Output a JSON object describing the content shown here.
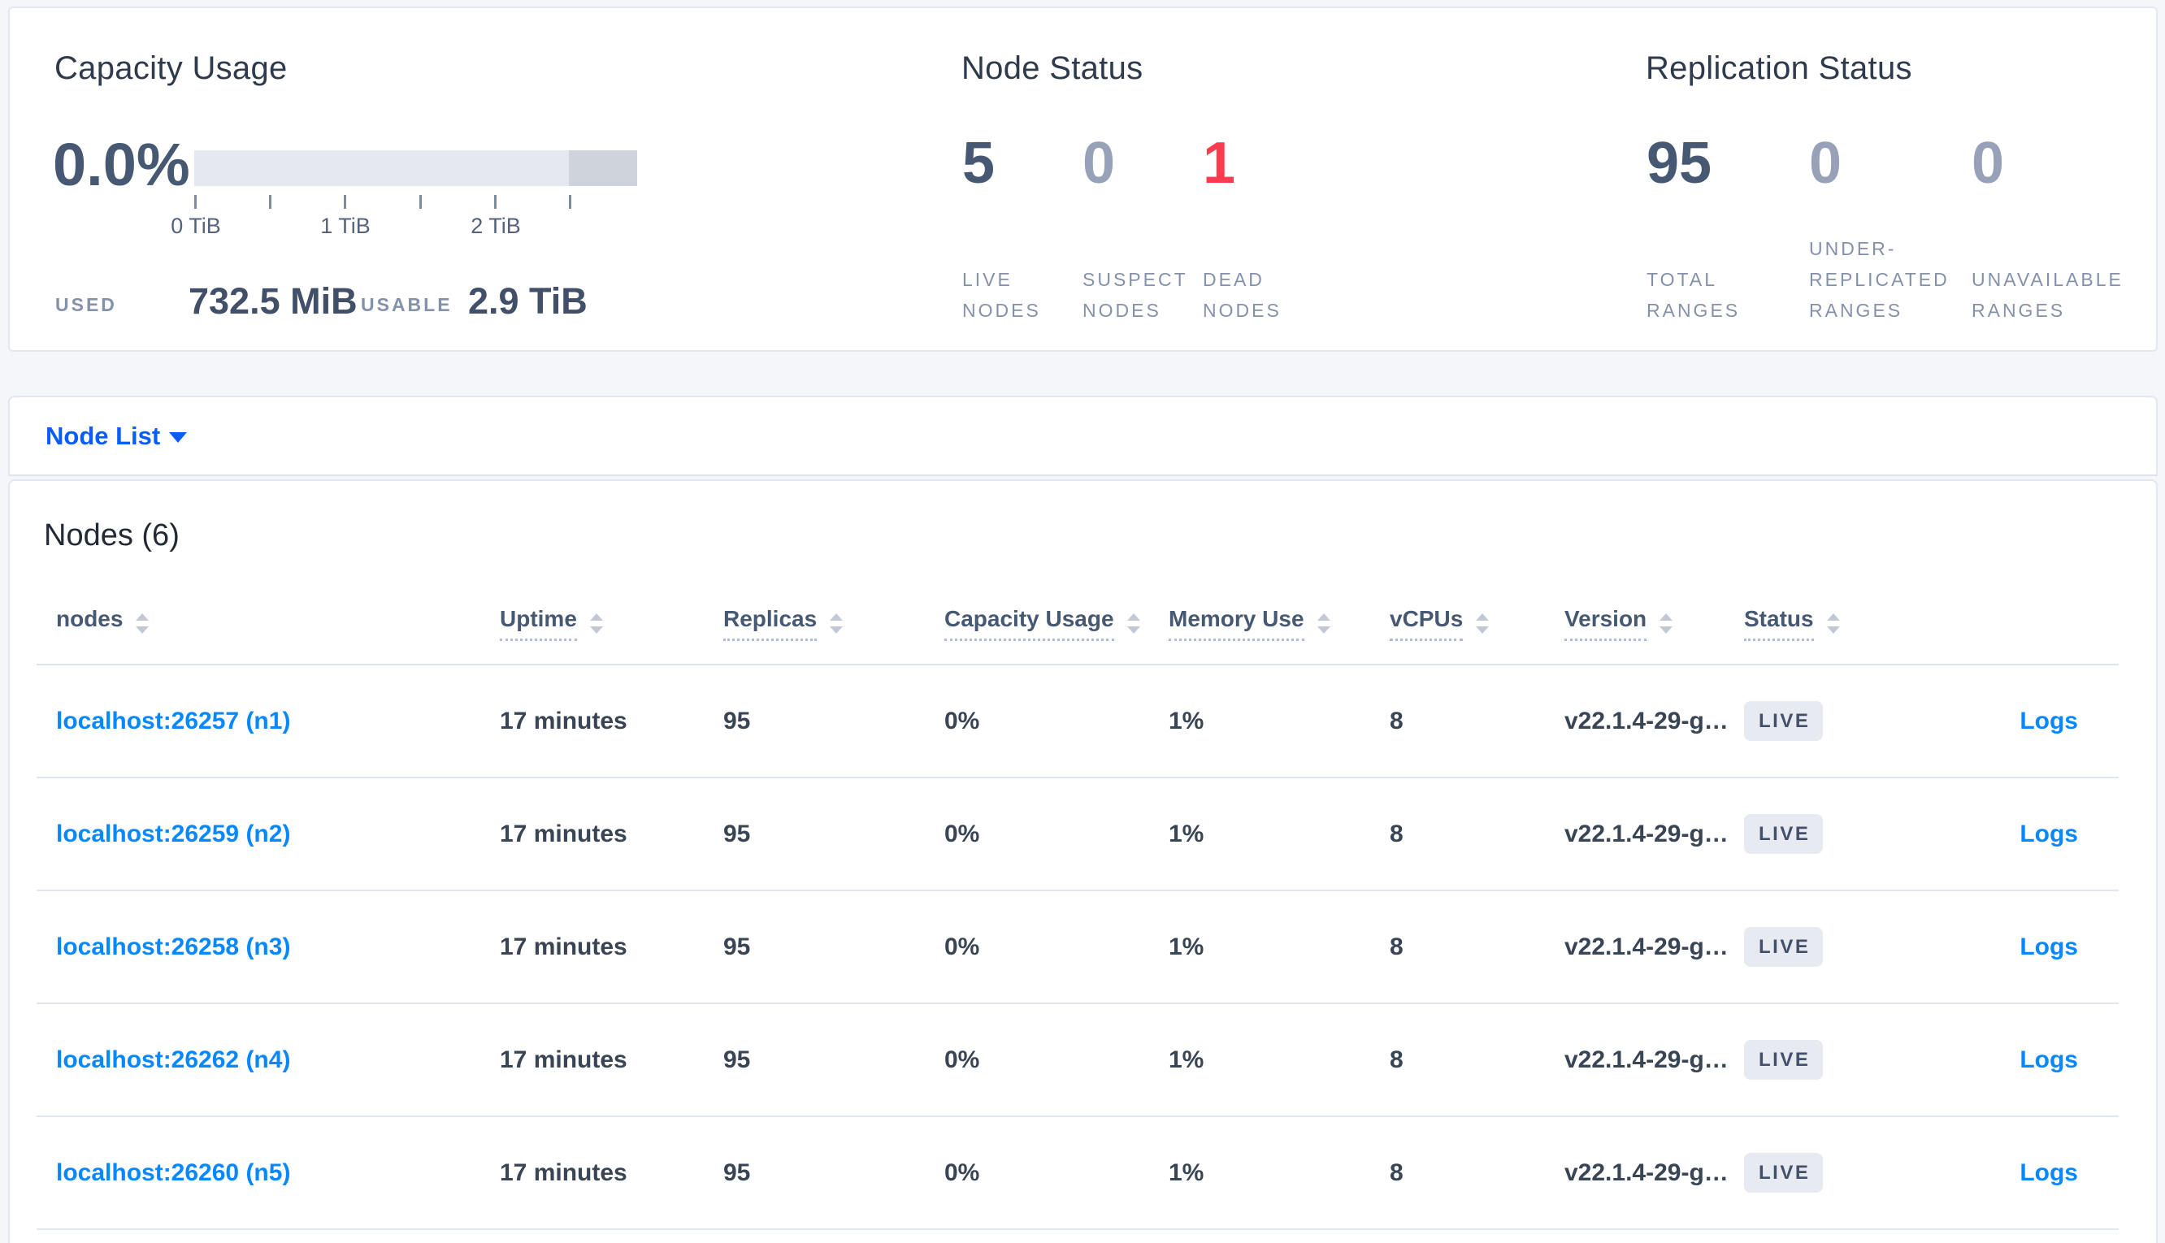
{
  "colors": {
    "page_bg": "#f4f6fa",
    "card_border": "#e3e7ef",
    "heading": "#2f3a4d",
    "metric_dark": "#475872",
    "metric_muted": "#97a1b7",
    "danger_red": "#fb3b4e",
    "label_muted": "#8591aa",
    "link_blue": "#0788ff",
    "selector_blue": "#0b5cff",
    "cell_text": "#394455",
    "row_border": "#e2e6ef",
    "badge_bg": "#e7eaf1",
    "bar_light": "#e5e8ee",
    "bar_dark": "#ced3dc"
  },
  "summary": {
    "capacity": {
      "title": "Capacity Usage",
      "percent": "0.0%",
      "bar": {
        "light_pct": 84.6,
        "dark_pct": 15.4
      },
      "tick_labels": [
        "0 TiB",
        "1 TiB",
        "2 TiB"
      ],
      "used_label": "USED",
      "used_value": "732.5 MiB",
      "usable_label": "USABLE",
      "usable_value": "2.9 TiB"
    },
    "node_status": {
      "title": "Node Status",
      "metrics": [
        {
          "value": "5",
          "label": "LIVE\nNODES",
          "tone": "dark"
        },
        {
          "value": "0",
          "label": "SUSPECT\nNODES",
          "tone": "muted"
        },
        {
          "value": "1",
          "label": "DEAD\nNODES",
          "tone": "danger"
        }
      ]
    },
    "replication": {
      "title": "Replication Status",
      "metrics": [
        {
          "value": "95",
          "label": "TOTAL\nRANGES",
          "tone": "dark"
        },
        {
          "value": "0",
          "label": "UNDER-\nREPLICATED\nRANGES",
          "tone": "muted"
        },
        {
          "value": "0",
          "label": "UNAVAILABLE\nRANGES",
          "tone": "muted"
        }
      ]
    }
  },
  "view_selector": {
    "label": "Node List"
  },
  "nodes_section": {
    "title": "Nodes (6)",
    "columns": [
      {
        "key": "address",
        "label": "nodes",
        "sort_icon": true,
        "tooltip_underline": false
      },
      {
        "key": "uptime",
        "label": "Uptime",
        "sort_icon": true,
        "tooltip_underline": true
      },
      {
        "key": "replicas",
        "label": "Replicas",
        "sort_icon": true,
        "tooltip_underline": true
      },
      {
        "key": "capacity",
        "label": "Capacity Usage",
        "sort_icon": true,
        "tooltip_underline": true
      },
      {
        "key": "memory",
        "label": "Memory Use",
        "sort_icon": true,
        "tooltip_underline": true
      },
      {
        "key": "vcpus",
        "label": "vCPUs",
        "sort_icon": true,
        "tooltip_underline": true
      },
      {
        "key": "version",
        "label": "Version",
        "sort_icon": true,
        "tooltip_underline": true
      },
      {
        "key": "status",
        "label": "Status",
        "sort_icon": true,
        "tooltip_underline": true
      },
      {
        "key": "logs",
        "label": "",
        "sort_icon": false,
        "tooltip_underline": false
      }
    ],
    "rows": [
      {
        "address": "localhost:26257 (n1)",
        "uptime": "17 minutes",
        "replicas": "95",
        "capacity": "0%",
        "memory": "1%",
        "vcpus": "8",
        "version": "v22.1.4-29-g…",
        "status": "LIVE",
        "logs": "Logs"
      },
      {
        "address": "localhost:26259 (n2)",
        "uptime": "17 minutes",
        "replicas": "95",
        "capacity": "0%",
        "memory": "1%",
        "vcpus": "8",
        "version": "v22.1.4-29-g…",
        "status": "LIVE",
        "logs": "Logs"
      },
      {
        "address": "localhost:26258 (n3)",
        "uptime": "17 minutes",
        "replicas": "95",
        "capacity": "0%",
        "memory": "1%",
        "vcpus": "8",
        "version": "v22.1.4-29-g…",
        "status": "LIVE",
        "logs": "Logs"
      },
      {
        "address": "localhost:26262 (n4)",
        "uptime": "17 minutes",
        "replicas": "95",
        "capacity": "0%",
        "memory": "1%",
        "vcpus": "8",
        "version": "v22.1.4-29-g…",
        "status": "LIVE",
        "logs": "Logs"
      },
      {
        "address": "localhost:26260 (n5)",
        "uptime": "17 minutes",
        "replicas": "95",
        "capacity": "0%",
        "memory": "1%",
        "vcpus": "8",
        "version": "v22.1.4-29-g…",
        "status": "LIVE",
        "logs": "Logs"
      }
    ]
  }
}
